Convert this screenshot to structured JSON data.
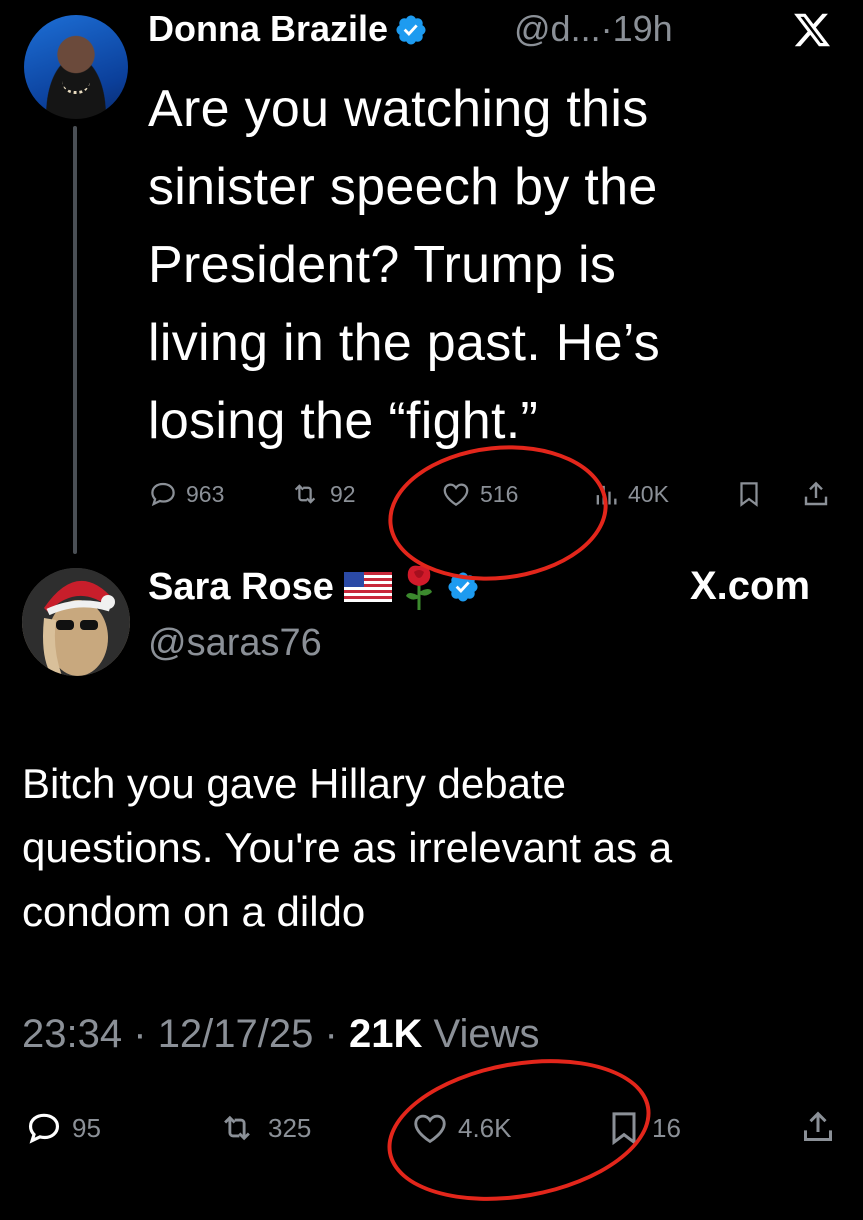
{
  "parent_tweet": {
    "display_name": "Donna Brazile",
    "handle": "@d...",
    "separator": "·",
    "time": "19h",
    "text": "Are you watching this\nsinister speech by the\nPresident? Trump is\nliving in the past. He’s\nlosing the “fight.”",
    "actions": {
      "replies": "963",
      "reposts": "92",
      "likes": "516",
      "views": "40K"
    }
  },
  "reply_tweet": {
    "display_name": "Sara Rose",
    "handle": "@saras76",
    "watermark": "X.com",
    "text": "Bitch you gave Hillary debate\nquestions. You're as irrelevant as a\ncondom on a dildo",
    "time": "23:34",
    "separator": "·",
    "date": "12/17/25",
    "views_count": "21K",
    "views_label": "Views",
    "actions": {
      "replies": "95",
      "reposts": "325",
      "likes": "4.6K",
      "bookmarks": "16"
    }
  },
  "colors": {
    "background": "#000000",
    "text": "#ffffff",
    "muted": "#8b9097",
    "verified": "#1d9bf0",
    "annotation_circle": "#e3261b"
  }
}
